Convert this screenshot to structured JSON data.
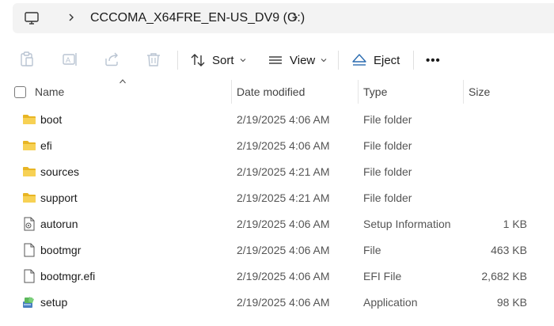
{
  "address": {
    "location": "CCCOMA_X64FRE_EN-US_DV9 (G:)"
  },
  "toolbar": {
    "sort_label": "Sort",
    "view_label": "View",
    "eject_label": "Eject",
    "more_label": "•••"
  },
  "columns": {
    "name": "Name",
    "date": "Date modified",
    "type": "Type",
    "size": "Size"
  },
  "files": [
    {
      "name": "boot",
      "date": "2/19/2025 4:06 AM",
      "type": "File folder",
      "size": "",
      "icon": "folder-icon"
    },
    {
      "name": "efi",
      "date": "2/19/2025 4:06 AM",
      "type": "File folder",
      "size": "",
      "icon": "folder-icon"
    },
    {
      "name": "sources",
      "date": "2/19/2025 4:21 AM",
      "type": "File folder",
      "size": "",
      "icon": "folder-icon"
    },
    {
      "name": "support",
      "date": "2/19/2025 4:21 AM",
      "type": "File folder",
      "size": "",
      "icon": "folder-icon"
    },
    {
      "name": "autorun",
      "date": "2/19/2025 4:06 AM",
      "type": "Setup Information",
      "size": "1 KB",
      "icon": "setup-info-icon"
    },
    {
      "name": "bootmgr",
      "date": "2/19/2025 4:06 AM",
      "type": "File",
      "size": "463 KB",
      "icon": "file-icon"
    },
    {
      "name": "bootmgr.efi",
      "date": "2/19/2025 4:06 AM",
      "type": "EFI File",
      "size": "2,682 KB",
      "icon": "file-icon"
    },
    {
      "name": "setup",
      "date": "2/19/2025 4:06 AM",
      "type": "Application",
      "size": "98 KB",
      "icon": "setup-app-icon"
    }
  ],
  "colors": {
    "folder": "#F2C744",
    "eject_accent": "#2B6CB0",
    "address_bg": "#F3F3F3"
  }
}
